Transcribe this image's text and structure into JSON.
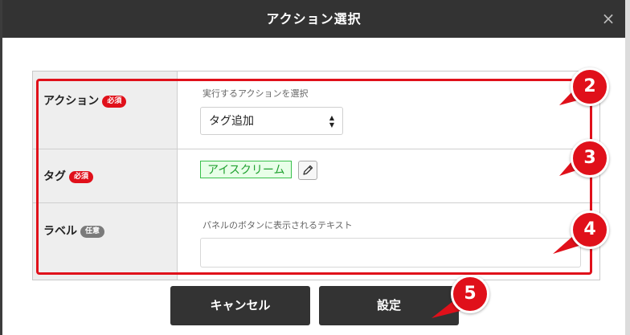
{
  "dialog": {
    "title": "アクション選択",
    "close_symbol": "×"
  },
  "form": {
    "action": {
      "label": "アクション",
      "badge": "必須",
      "hint": "実行するアクションを選択",
      "selected": "タグ追加"
    },
    "tag": {
      "label": "タグ",
      "badge": "必須",
      "value": "アイスクリーム",
      "edit_icon": "pencil-icon"
    },
    "label_field": {
      "label": "ラベル",
      "badge": "任意",
      "hint": "パネルのボタンに表示されるテキスト",
      "value": ""
    }
  },
  "buttons": {
    "cancel": "キャンセル",
    "confirm": "設定"
  },
  "callouts": [
    "2",
    "3",
    "4",
    "5"
  ],
  "colors": {
    "header_bg": "#333333",
    "required_badge": "#e0101a",
    "optional_badge": "#7a7a7a",
    "tag_border": "#37c04a",
    "annotation_red": "#e0101a"
  }
}
